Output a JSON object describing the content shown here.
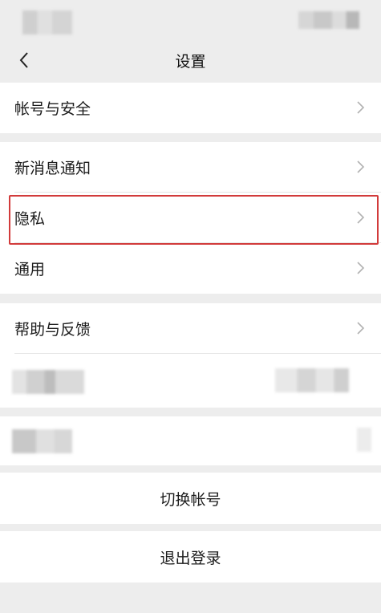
{
  "header": {
    "title": "设置",
    "back_icon": "chevron-left-icon"
  },
  "sections": {
    "account_security": "帐号与安全",
    "new_message_notifications": "新消息通知",
    "privacy": "隐私",
    "general": "通用",
    "help_feedback": "帮助与反馈"
  },
  "actions": {
    "switch_account": "切换帐号",
    "log_out": "退出登录"
  },
  "colors": {
    "background": "#ededed",
    "cell": "#ffffff",
    "highlight_border": "#d23b3b",
    "chevron": "#b2b2b2"
  }
}
